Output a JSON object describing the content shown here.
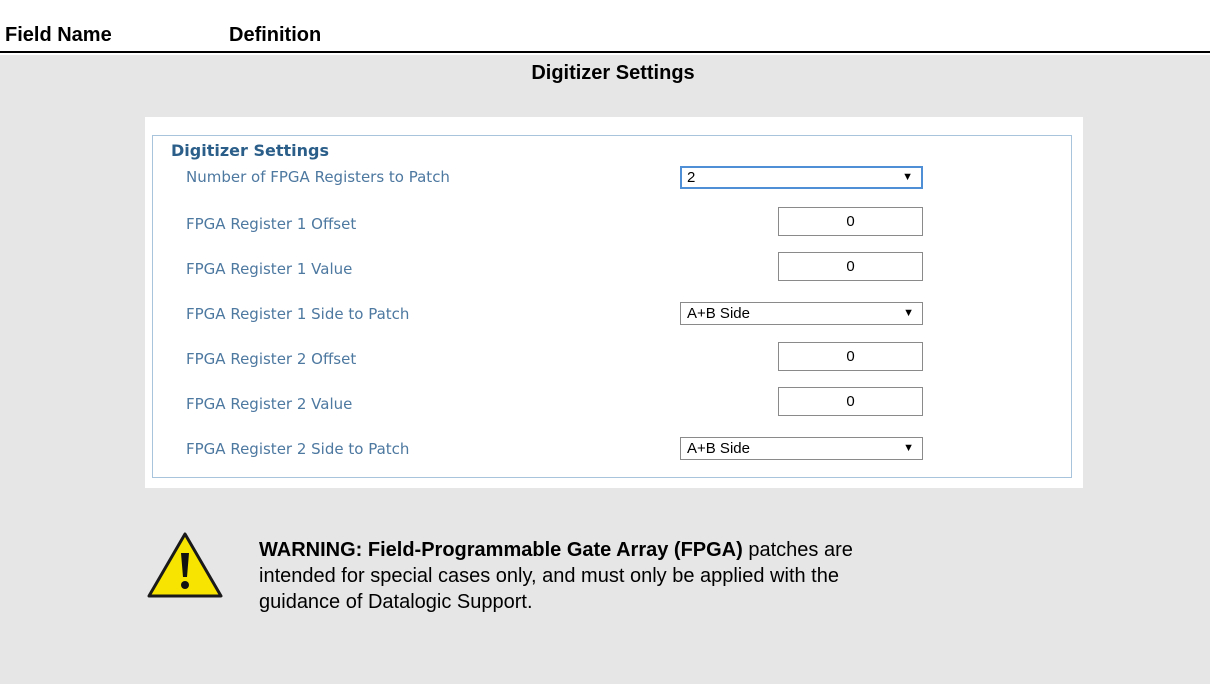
{
  "table_header": {
    "field_name": "Field Name",
    "definition": "Definition"
  },
  "section_title": "Digitizer Settings",
  "panel": {
    "legend": "Digitizer Settings",
    "rows": [
      {
        "label": "Number of FPGA Registers to Patch",
        "control": "select",
        "value": "2"
      },
      {
        "label": "FPGA Register 1 Offset",
        "control": "number",
        "value": "0"
      },
      {
        "label": "FPGA Register 1 Value",
        "control": "number",
        "value": "0"
      },
      {
        "label": "FPGA Register 1 Side to Patch",
        "control": "select",
        "value": "A+B Side"
      },
      {
        "label": "FPGA Register 2 Offset",
        "control": "number",
        "value": "0"
      },
      {
        "label": "FPGA Register 2 Value",
        "control": "number",
        "value": "0"
      },
      {
        "label": "FPGA Register 2 Side to Patch",
        "control": "select",
        "value": "A+B Side"
      }
    ]
  },
  "warning": {
    "icon": "warning-triangle-icon",
    "bold_text": "WARNING: Field-Programmable Gate Array (FPGA)",
    "text": " patches are intended for special cases only, and must only be applied with the guidance of Datalogic Support."
  },
  "colors": {
    "label": "#4d78a0",
    "legend": "#2b5f8a",
    "border": "#a8c4dc",
    "page_bg": "#e6e6e6",
    "warning_fill": "#f7e400"
  }
}
